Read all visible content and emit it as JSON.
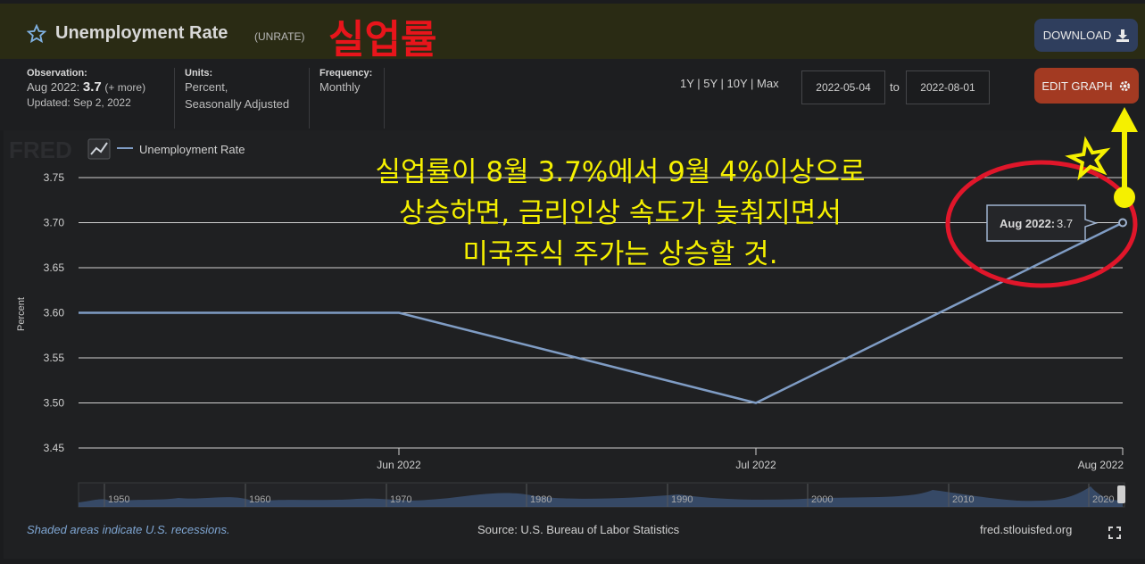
{
  "header": {
    "title": "Unemployment Rate",
    "series_id": "(UNRATE)",
    "annotation_korean": "실업률",
    "download_label": "DOWNLOAD"
  },
  "meta": {
    "observation_label": "Observation:",
    "observation_date": "Aug 2022:",
    "observation_value": "3.7",
    "observation_more": "(+ more)",
    "updated": "Updated: Sep 2, 2022",
    "units_label": "Units:",
    "units_line1": "Percent,",
    "units_line2": "Seasonally Adjusted",
    "frequency_label": "Frequency:",
    "frequency_value": "Monthly"
  },
  "controls": {
    "ranges": "1Y | 5Y | 10Y | Max",
    "date_from": "2022-05-04",
    "to_label": "to",
    "date_to": "2022-08-01",
    "edit_graph_label": "EDIT GRAPH"
  },
  "watermark": "FRED",
  "annotation_yellow": [
    "실업률이 8월 3.7%에서 9월 4%이상으로",
    "상승하면, 금리인상 속도가 늦춰지면서",
    "미국주식 주가는 상승할 것."
  ],
  "tooltip": {
    "label": "Aug 2022:",
    "value": "3.7"
  },
  "footer": {
    "recessions": "Shaded areas indicate U.S. recessions.",
    "source": "Source: U.S. Bureau of Labor Statistics",
    "site": "fred.stlouisfed.org"
  },
  "colors": {
    "line": "#7f9cc4",
    "annotation_red": "#e8151b",
    "annotation_yellow": "#f5f000",
    "edit_button": "#a33a22",
    "download_button": "#2f3e5d"
  },
  "chart_data": {
    "type": "line",
    "x": [
      "May 2022",
      "Jun 2022",
      "Jul 2022",
      "Aug 2022"
    ],
    "xtick_labels": [
      "Jun 2022",
      "Jul 2022",
      "Aug 2022"
    ],
    "series": [
      {
        "name": "Unemployment Rate",
        "values": [
          3.6,
          3.6,
          3.5,
          3.7
        ]
      }
    ],
    "ylabel": "Percent",
    "ylim": [
      3.45,
      3.75
    ],
    "yticks": [
      "3.75",
      "3.70",
      "3.65",
      "3.60",
      "3.55",
      "3.50",
      "3.45"
    ],
    "grid": true,
    "legend": "top-left",
    "navigator_labels": [
      "1950",
      "1960",
      "1970",
      "1980",
      "1990",
      "2000",
      "2010",
      "2020"
    ]
  }
}
